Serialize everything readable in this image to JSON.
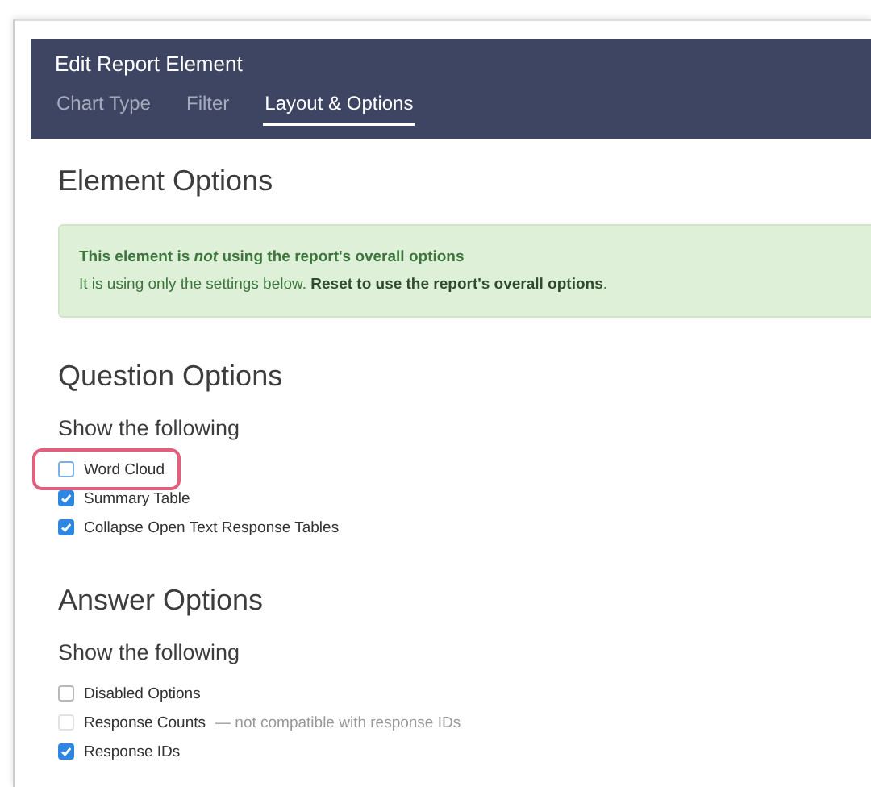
{
  "window": {
    "title": "Edit Report Element"
  },
  "tabs": [
    {
      "label": "Chart Type",
      "selected": false
    },
    {
      "label": "Filter",
      "selected": false
    },
    {
      "label": "Layout & Options",
      "selected": true
    }
  ],
  "element_options": {
    "heading": "Element Options",
    "notice": {
      "title": "This element is *not* using the report's overall options",
      "text": "It is using only the settings below.",
      "link": "Reset to use the report's overall options",
      "after_link": "."
    }
  },
  "sections": [
    {
      "heading": "Question Options",
      "subheading": "Show the following",
      "options": [
        {
          "label": "Word Cloud",
          "checked": false,
          "disabled": false,
          "highlighted": true
        },
        {
          "label": "Summary Table",
          "checked": true,
          "disabled": false,
          "highlighted": false
        },
        {
          "label": "Collapse Open Text Response Tables",
          "checked": true,
          "disabled": false,
          "highlighted": false
        }
      ]
    },
    {
      "heading": "Answer Options",
      "subheading": "Show the following",
      "options": [
        {
          "label": "Disabled Options",
          "checked": false,
          "disabled": false,
          "highlighted": false
        },
        {
          "label": "Response Counts",
          "note": "— not compatible with response IDs",
          "checked": false,
          "disabled": true,
          "highlighted": false
        },
        {
          "label": "Response IDs",
          "checked": true,
          "disabled": false,
          "highlighted": false
        }
      ]
    }
  ]
}
